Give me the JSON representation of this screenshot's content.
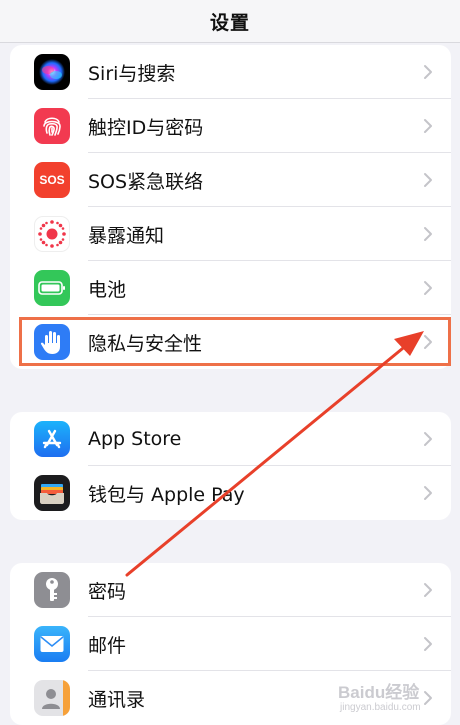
{
  "nav": {
    "title": "设置"
  },
  "group1": [
    {
      "label": "Siri与搜索",
      "icon": "siri-icon"
    },
    {
      "label": "触控ID与密码",
      "icon": "fingerprint-icon"
    },
    {
      "label": "SOS紧急联络",
      "icon": "sos-icon",
      "icon_text": "SOS"
    },
    {
      "label": "暴露通知",
      "icon": "exposure-icon"
    },
    {
      "label": "电池",
      "icon": "battery-icon"
    },
    {
      "label": "隐私与安全性",
      "icon": "privacy-hand-icon"
    }
  ],
  "group2": [
    {
      "label": "App Store",
      "icon": "app-store-icon"
    },
    {
      "label": "钱包与 Apple Pay",
      "icon": "wallet-icon"
    }
  ],
  "group3": [
    {
      "label": "密码",
      "icon": "key-icon"
    },
    {
      "label": "邮件",
      "icon": "mail-icon"
    },
    {
      "label": "通讯录",
      "icon": "contacts-icon"
    }
  ],
  "watermark": {
    "brand": "Baidu经验",
    "url": "jingyan.baidu.com"
  },
  "colors": {
    "highlight": "#ee7048",
    "arrow": "#e8402a",
    "background": "#f2f2f7"
  }
}
